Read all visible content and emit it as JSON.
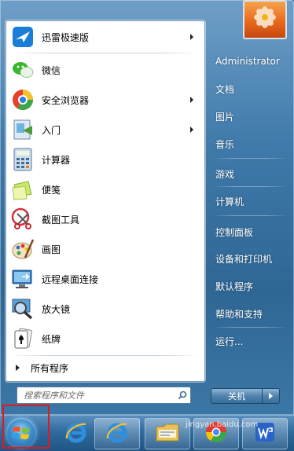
{
  "start_menu": {
    "pinned_programs": [
      {
        "label": "迅雷极速版",
        "icon": "xunlei-bird-icon",
        "has_submenu": true
      },
      {
        "label": "微信",
        "icon": "wechat-icon",
        "has_submenu": false
      },
      {
        "label": "安全浏览器",
        "icon": "360-browser-icon",
        "has_submenu": true
      },
      {
        "label": "入门",
        "icon": "getting-started-icon",
        "has_submenu": true
      },
      {
        "label": "计算器",
        "icon": "calculator-icon",
        "has_submenu": false
      },
      {
        "label": "便笺",
        "icon": "sticky-notes-icon",
        "has_submenu": false
      },
      {
        "label": "截图工具",
        "icon": "snipping-tool-icon",
        "has_submenu": false
      },
      {
        "label": "画图",
        "icon": "paint-icon",
        "has_submenu": false
      },
      {
        "label": "远程桌面连接",
        "icon": "remote-desktop-icon",
        "has_submenu": false
      },
      {
        "label": "放大镜",
        "icon": "magnifier-icon",
        "has_submenu": false
      },
      {
        "label": "纸牌",
        "icon": "solitaire-icon",
        "has_submenu": false
      }
    ],
    "all_programs_label": "所有程序",
    "search": {
      "placeholder": "搜索程序和文件"
    },
    "right_links": [
      {
        "label": "Administrator"
      },
      {
        "label": "文档"
      },
      {
        "label": "图片"
      },
      {
        "label": "音乐"
      },
      {
        "label": "游戏"
      },
      {
        "label": "计算机"
      },
      {
        "label": "控制面板"
      },
      {
        "label": "设备和打印机"
      },
      {
        "label": "默认程序"
      },
      {
        "label": "帮助和支持"
      },
      {
        "label": "运行..."
      }
    ],
    "shutdown_label": "关机"
  },
  "taskbar": {
    "items": [
      {
        "icon": "windows-start-orb-icon",
        "highlighted": true
      },
      {
        "icon": "internet-explorer-icon"
      },
      {
        "icon": "internet-explorer-icon"
      },
      {
        "icon": "file-explorer-folder-icon"
      },
      {
        "icon": "chrome-icon"
      },
      {
        "icon": "wps-icon"
      }
    ],
    "watermark": "jingyan.baidu.com"
  },
  "colors": {
    "highlight_box": "#e0191f",
    "menu_blue": "#3f7aaa"
  }
}
